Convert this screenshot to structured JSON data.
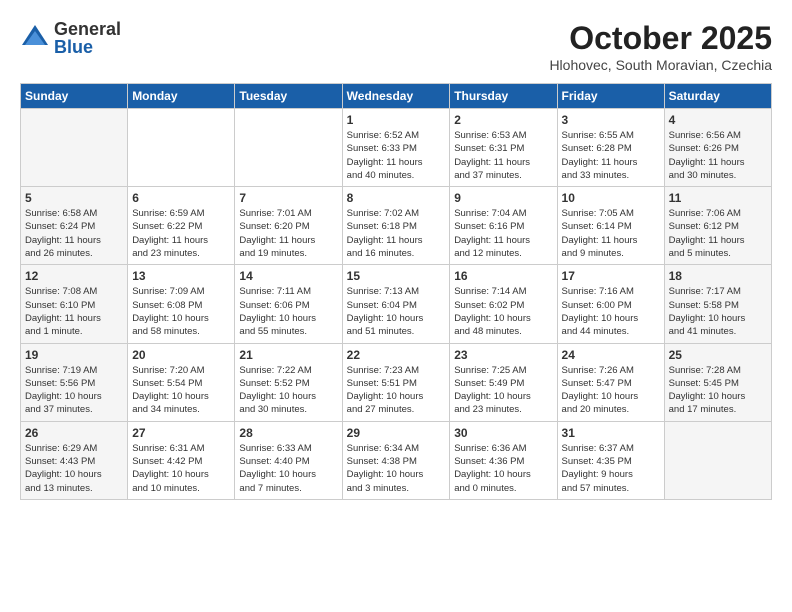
{
  "header": {
    "logo_general": "General",
    "logo_blue": "Blue",
    "month_title": "October 2025",
    "location": "Hlohovec, South Moravian, Czechia"
  },
  "weekdays": [
    "Sunday",
    "Monday",
    "Tuesday",
    "Wednesday",
    "Thursday",
    "Friday",
    "Saturday"
  ],
  "weeks": [
    [
      {
        "day": "",
        "info": ""
      },
      {
        "day": "",
        "info": ""
      },
      {
        "day": "",
        "info": ""
      },
      {
        "day": "1",
        "info": "Sunrise: 6:52 AM\nSunset: 6:33 PM\nDaylight: 11 hours\nand 40 minutes."
      },
      {
        "day": "2",
        "info": "Sunrise: 6:53 AM\nSunset: 6:31 PM\nDaylight: 11 hours\nand 37 minutes."
      },
      {
        "day": "3",
        "info": "Sunrise: 6:55 AM\nSunset: 6:28 PM\nDaylight: 11 hours\nand 33 minutes."
      },
      {
        "day": "4",
        "info": "Sunrise: 6:56 AM\nSunset: 6:26 PM\nDaylight: 11 hours\nand 30 minutes."
      }
    ],
    [
      {
        "day": "5",
        "info": "Sunrise: 6:58 AM\nSunset: 6:24 PM\nDaylight: 11 hours\nand 26 minutes."
      },
      {
        "day": "6",
        "info": "Sunrise: 6:59 AM\nSunset: 6:22 PM\nDaylight: 11 hours\nand 23 minutes."
      },
      {
        "day": "7",
        "info": "Sunrise: 7:01 AM\nSunset: 6:20 PM\nDaylight: 11 hours\nand 19 minutes."
      },
      {
        "day": "8",
        "info": "Sunrise: 7:02 AM\nSunset: 6:18 PM\nDaylight: 11 hours\nand 16 minutes."
      },
      {
        "day": "9",
        "info": "Sunrise: 7:04 AM\nSunset: 6:16 PM\nDaylight: 11 hours\nand 12 minutes."
      },
      {
        "day": "10",
        "info": "Sunrise: 7:05 AM\nSunset: 6:14 PM\nDaylight: 11 hours\nand 9 minutes."
      },
      {
        "day": "11",
        "info": "Sunrise: 7:06 AM\nSunset: 6:12 PM\nDaylight: 11 hours\nand 5 minutes."
      }
    ],
    [
      {
        "day": "12",
        "info": "Sunrise: 7:08 AM\nSunset: 6:10 PM\nDaylight: 11 hours\nand 1 minute."
      },
      {
        "day": "13",
        "info": "Sunrise: 7:09 AM\nSunset: 6:08 PM\nDaylight: 10 hours\nand 58 minutes."
      },
      {
        "day": "14",
        "info": "Sunrise: 7:11 AM\nSunset: 6:06 PM\nDaylight: 10 hours\nand 55 minutes."
      },
      {
        "day": "15",
        "info": "Sunrise: 7:13 AM\nSunset: 6:04 PM\nDaylight: 10 hours\nand 51 minutes."
      },
      {
        "day": "16",
        "info": "Sunrise: 7:14 AM\nSunset: 6:02 PM\nDaylight: 10 hours\nand 48 minutes."
      },
      {
        "day": "17",
        "info": "Sunrise: 7:16 AM\nSunset: 6:00 PM\nDaylight: 10 hours\nand 44 minutes."
      },
      {
        "day": "18",
        "info": "Sunrise: 7:17 AM\nSunset: 5:58 PM\nDaylight: 10 hours\nand 41 minutes."
      }
    ],
    [
      {
        "day": "19",
        "info": "Sunrise: 7:19 AM\nSunset: 5:56 PM\nDaylight: 10 hours\nand 37 minutes."
      },
      {
        "day": "20",
        "info": "Sunrise: 7:20 AM\nSunset: 5:54 PM\nDaylight: 10 hours\nand 34 minutes."
      },
      {
        "day": "21",
        "info": "Sunrise: 7:22 AM\nSunset: 5:52 PM\nDaylight: 10 hours\nand 30 minutes."
      },
      {
        "day": "22",
        "info": "Sunrise: 7:23 AM\nSunset: 5:51 PM\nDaylight: 10 hours\nand 27 minutes."
      },
      {
        "day": "23",
        "info": "Sunrise: 7:25 AM\nSunset: 5:49 PM\nDaylight: 10 hours\nand 23 minutes."
      },
      {
        "day": "24",
        "info": "Sunrise: 7:26 AM\nSunset: 5:47 PM\nDaylight: 10 hours\nand 20 minutes."
      },
      {
        "day": "25",
        "info": "Sunrise: 7:28 AM\nSunset: 5:45 PM\nDaylight: 10 hours\nand 17 minutes."
      }
    ],
    [
      {
        "day": "26",
        "info": "Sunrise: 6:29 AM\nSunset: 4:43 PM\nDaylight: 10 hours\nand 13 minutes."
      },
      {
        "day": "27",
        "info": "Sunrise: 6:31 AM\nSunset: 4:42 PM\nDaylight: 10 hours\nand 10 minutes."
      },
      {
        "day": "28",
        "info": "Sunrise: 6:33 AM\nSunset: 4:40 PM\nDaylight: 10 hours\nand 7 minutes."
      },
      {
        "day": "29",
        "info": "Sunrise: 6:34 AM\nSunset: 4:38 PM\nDaylight: 10 hours\nand 3 minutes."
      },
      {
        "day": "30",
        "info": "Sunrise: 6:36 AM\nSunset: 4:36 PM\nDaylight: 10 hours\nand 0 minutes."
      },
      {
        "day": "31",
        "info": "Sunrise: 6:37 AM\nSunset: 4:35 PM\nDaylight: 9 hours\nand 57 minutes."
      },
      {
        "day": "",
        "info": ""
      }
    ]
  ]
}
